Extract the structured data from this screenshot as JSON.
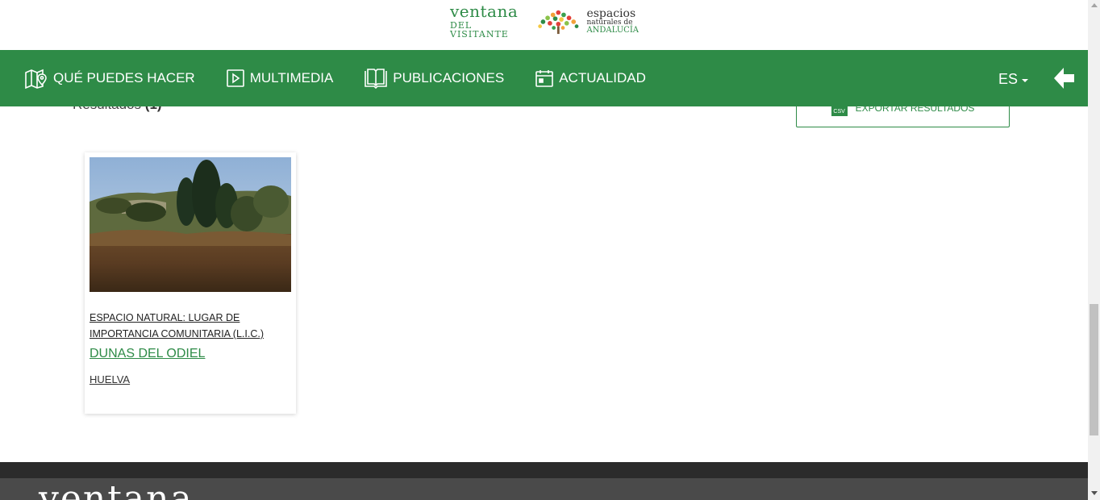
{
  "header": {
    "logo_left_top": "ventana",
    "logo_left_bottom": "DEL VISITANTE",
    "logo_right_line1": "espacios",
    "logo_right_line2": "naturales de",
    "logo_right_line3": "ANDALUCÍA"
  },
  "nav": {
    "items": [
      {
        "label": "QUÉ PUEDES HACER",
        "icon": "map-pin-icon"
      },
      {
        "label": "MULTIMEDIA",
        "icon": "play-icon"
      },
      {
        "label": "PUBLICACIONES",
        "icon": "book-icon"
      },
      {
        "label": "ACTUALIDAD",
        "icon": "calendar-icon"
      }
    ],
    "language": "ES",
    "back_icon": "arrow-left-icon"
  },
  "results": {
    "label": "Resultados",
    "count": "(1)",
    "export_label": "EXPORTAR RESULTADOS",
    "export_icon_text": "CSV"
  },
  "cards": [
    {
      "category": "ESPACIO NATURAL: LUGAR DE IMPORTANCIA COMUNITARIA (L.I.C.)",
      "title": "DUNAS DEL ODIEL",
      "province": "HUELVA"
    }
  ],
  "footer": {
    "logo_text": "ventana"
  },
  "colors": {
    "brand_green": "#2e8b47",
    "footer_dark": "#2b2b2b",
    "footer_gray": "#4a4a4a"
  }
}
